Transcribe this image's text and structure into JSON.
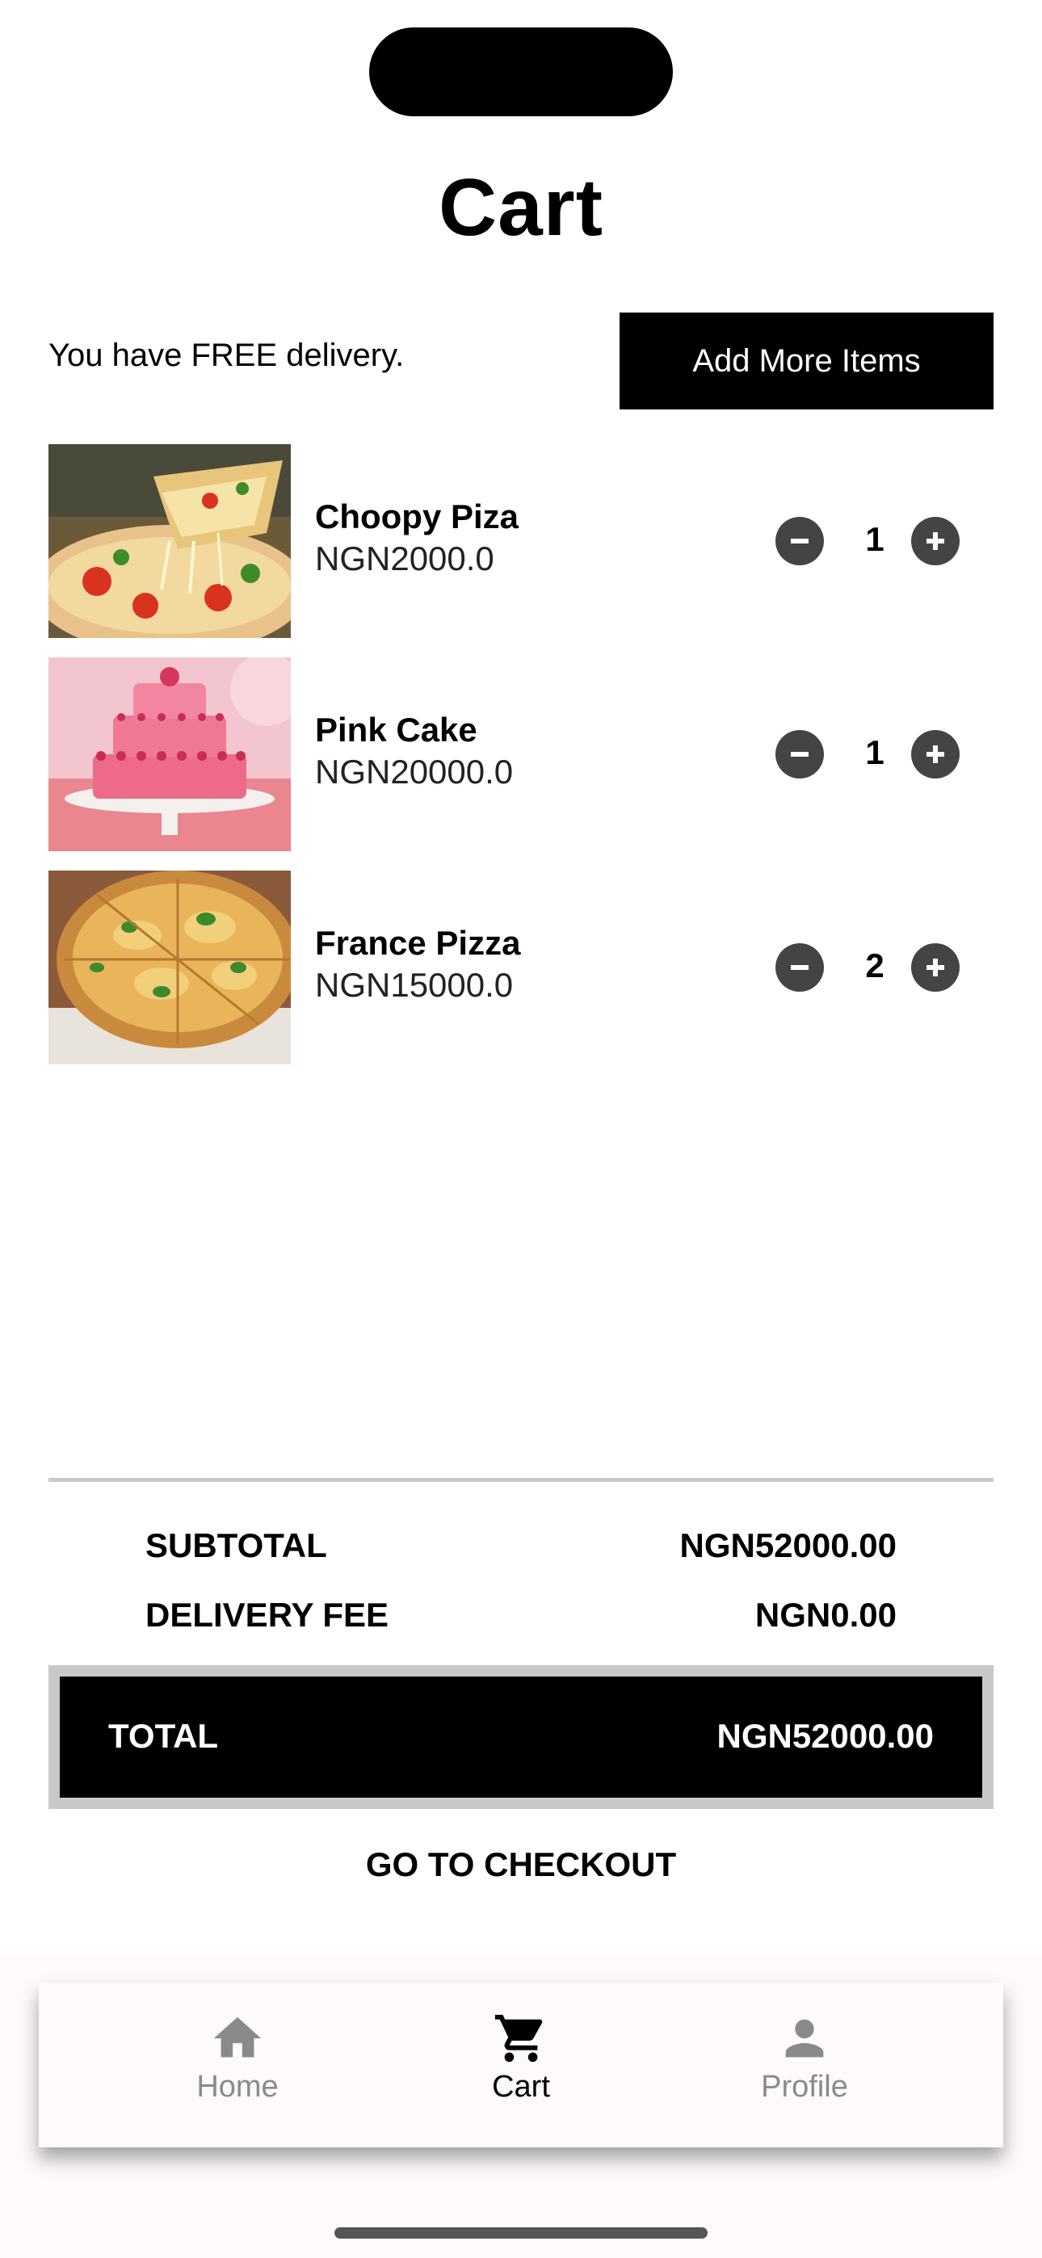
{
  "page": {
    "title": "Cart"
  },
  "header": {
    "delivery_message": "You have FREE delivery.",
    "add_more_label": "Add More Items"
  },
  "cart": {
    "items": [
      {
        "name": "Choopy Piza",
        "price": "NGN2000.0",
        "quantity": "1"
      },
      {
        "name": "Pink Cake",
        "price": "NGN20000.0",
        "quantity": "1"
      },
      {
        "name": "France Pizza",
        "price": "NGN15000.0",
        "quantity": "2"
      }
    ]
  },
  "summary": {
    "subtotal_label": "SUBTOTAL",
    "subtotal_value": "NGN52000.00",
    "delivery_label": "DELIVERY FEE",
    "delivery_value": "NGN0.00",
    "total_label": "TOTAL",
    "total_value": "NGN52000.00",
    "checkout_label": "GO TO CHECKOUT"
  },
  "tabbar": {
    "tabs": [
      {
        "label": "Home",
        "icon": "home-icon",
        "active": false
      },
      {
        "label": "Cart",
        "icon": "cart-icon",
        "active": true
      },
      {
        "label": "Profile",
        "icon": "person-icon",
        "active": false
      }
    ]
  },
  "colors": {
    "accent": "#000000",
    "quantity_button": "#444444",
    "inactive_tab": "#8a8a8a",
    "divider": "#c8c8d0"
  }
}
